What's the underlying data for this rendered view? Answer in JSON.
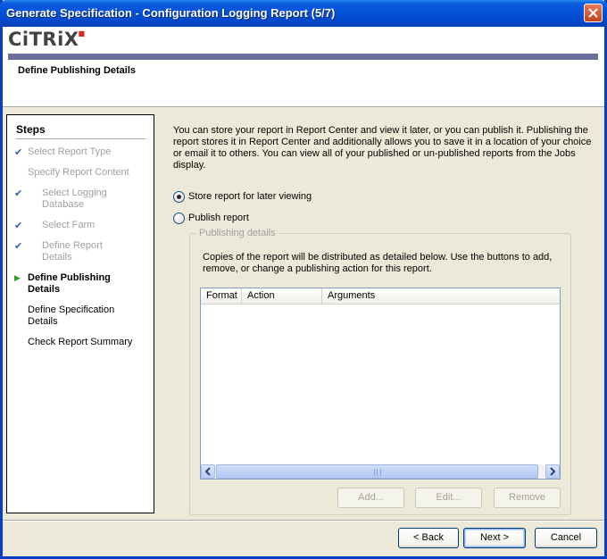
{
  "window": {
    "title": "Generate Specification - Configuration Logging Report (5/7)"
  },
  "header": {
    "logo_text": "CiTRiX",
    "page_title": "Define Publishing Details"
  },
  "steps": {
    "heading": "Steps",
    "items": [
      {
        "label": "Select Report Type",
        "state": "done",
        "marker": "check-icon"
      },
      {
        "label": "Specify Report Content",
        "state": "done",
        "marker": ""
      },
      {
        "label": "Select Logging Database",
        "state": "done",
        "marker": "check-icon"
      },
      {
        "label": "Select Farm",
        "state": "done",
        "marker": "check-icon"
      },
      {
        "label": "Define Report Details",
        "state": "done",
        "marker": "check-icon"
      },
      {
        "label": "Define Publishing Details",
        "state": "current",
        "marker": "arrow-icon"
      },
      {
        "label": "Define Specification Details",
        "state": "todo",
        "marker": ""
      },
      {
        "label": "Check Report Summary",
        "state": "todo",
        "marker": ""
      }
    ]
  },
  "main": {
    "intro": "You can store your report in Report Center and view it later, or you can publish it. Publishing the report stores it in Report Center and additionally allows you to save it in a location of your choice or email it to others. You can view all of your published or un-published reports from the Jobs display.",
    "options": [
      {
        "label": "Store report for later viewing",
        "checked": true
      },
      {
        "label": "Publish report",
        "checked": false
      }
    ],
    "group": {
      "legend": "Publishing details",
      "description": "Copies of the report will be distributed as detailed below. Use the buttons to add, remove, or change a publishing action for this report.",
      "columns": [
        "Format",
        "Action",
        "Arguments"
      ],
      "rows": [],
      "buttons": {
        "add": "Add...",
        "edit": "Edit...",
        "remove": "Remove"
      }
    }
  },
  "footer": {
    "back": "< Back",
    "next": "Next >",
    "cancel": "Cancel"
  }
}
